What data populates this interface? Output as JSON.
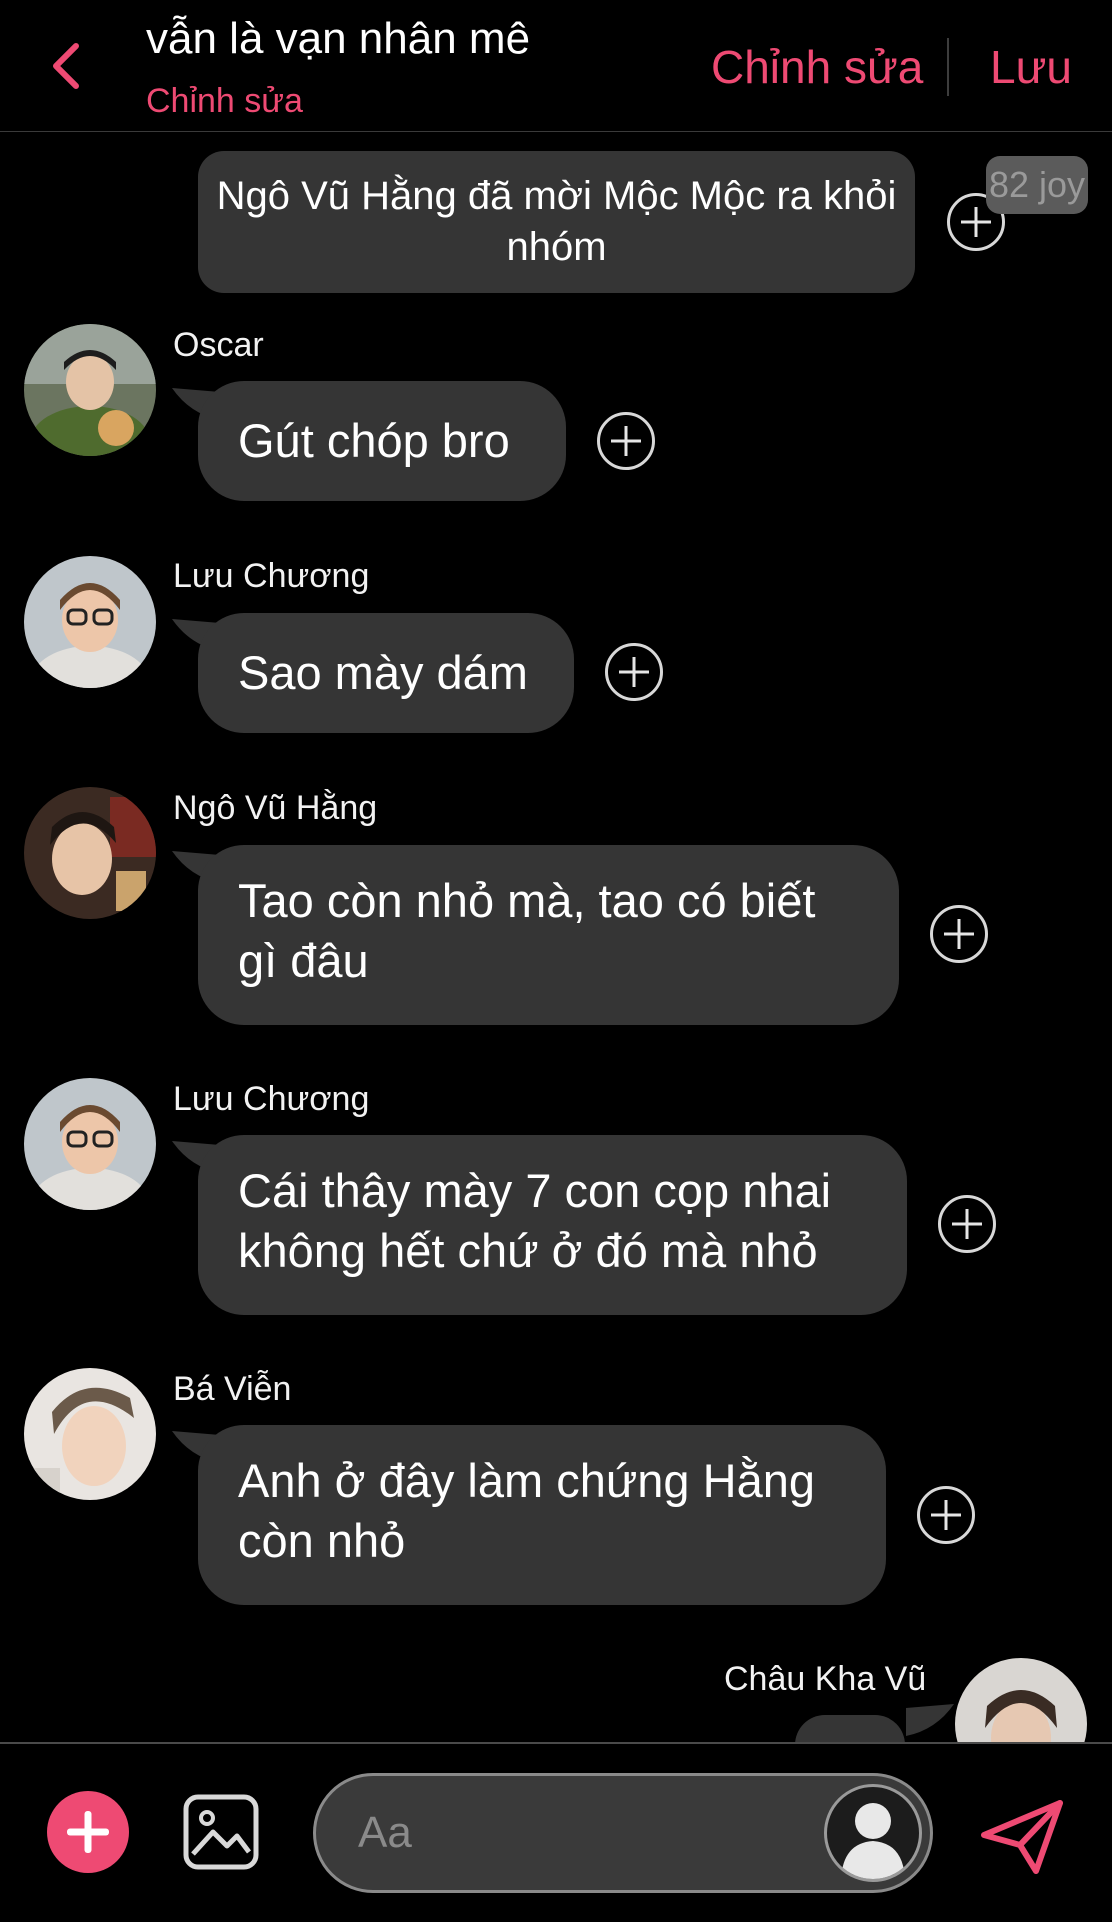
{
  "header": {
    "title": "vẫn là vạn nhân mê",
    "subtitle": "Chỉnh sửa",
    "edit_label": "Chỉnh sửa",
    "save_label": "Lưu"
  },
  "system_message": {
    "text": "Ngô Vũ Hằng đã mời Mộc Mộc ra khỏi nhóm",
    "badge": "82 joy"
  },
  "messages": [
    {
      "sender": "Oscar",
      "text": "Gút chóp bro"
    },
    {
      "sender": "Lưu Chương",
      "text": "Sao mày dám"
    },
    {
      "sender": "Ngô Vũ Hằng",
      "line1": "Tao còn nhỏ mà, tao có biết",
      "line2": "gì đâu"
    },
    {
      "sender": "Lưu Chương",
      "line1": "Cái thây mày 7 con cọp nhai",
      "line2": "không hết chứ ở đó mà nhỏ"
    },
    {
      "sender": "Bá Viễn",
      "line1": "Anh ở đây làm chứng Hằng",
      "line2": "còn nhỏ"
    },
    {
      "sender": "Châu Kha Vũ",
      "text": ""
    }
  ],
  "composer": {
    "placeholder": "Aa"
  },
  "colors": {
    "accent": "#ee4a73",
    "bubble": "#353535",
    "background": "#000000"
  },
  "icons": [
    "back-chevron-icon",
    "plus-circle-icon",
    "add-icon",
    "image-icon",
    "person-icon",
    "send-icon"
  ]
}
